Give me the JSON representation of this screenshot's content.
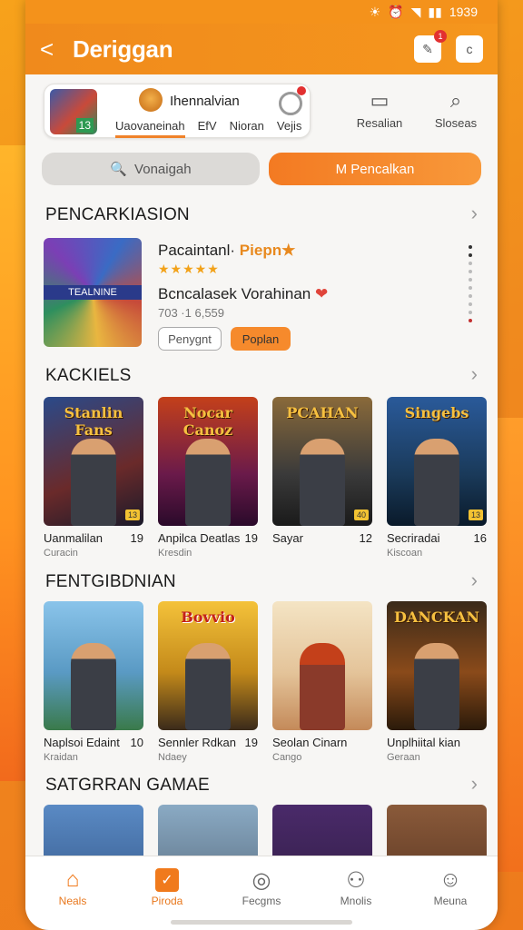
{
  "status_bar": {
    "time": "1939"
  },
  "app_bar": {
    "title": "Deriggan",
    "back_icon": "back-arrow-icon",
    "badge_count": "1",
    "right_icon": "c"
  },
  "category_strip": {
    "thumb_number": "13",
    "heading": "Ihennalvian",
    "tabs": [
      {
        "label": "Uaovaneinah",
        "active": true
      },
      {
        "label": "EfV",
        "active": false
      },
      {
        "label": "Nioran",
        "active": false
      },
      {
        "label": "Vejis",
        "active": false
      }
    ]
  },
  "side_actions": [
    {
      "label": "Resalian",
      "icon": "router-icon"
    },
    {
      "label": "Sloseas",
      "icon": "search-clock-icon"
    }
  ],
  "search": {
    "placeholder": "Vonaigah",
    "cta": "M Pencalkan"
  },
  "featured": {
    "section_title": "PENCARKIASION",
    "cover_band": "TEALNINE",
    "title": "Pacaintanl·",
    "title_highlight": "Piepn★",
    "stars": "★★★★★",
    "subtitle": "Bcncalasek  Vorahinan",
    "count": "703 ·1 6,559",
    "btn_outline": "Penygnt",
    "btn_fill": "Poplan"
  },
  "sections": [
    {
      "title": "KACKIELS",
      "games": [
        {
          "cover": "Stanlin Fans",
          "name": "Uanmalilan",
          "num": "19",
          "sub": "Curacin",
          "tag": "13"
        },
        {
          "cover": "Nocar Canoz",
          "name": "Anpilca Deatlas",
          "num": "19",
          "sub": "Kresdin",
          "tag": ""
        },
        {
          "cover": "PCAHAN",
          "name": "Sayar",
          "num": "12",
          "sub": "",
          "tag": "40"
        },
        {
          "cover": "Singebs",
          "name": "Secriradai",
          "num": "16",
          "sub": "Kiscoan",
          "tag": "13"
        }
      ]
    },
    {
      "title": "FENTGIBDNIAN",
      "games": [
        {
          "cover": "",
          "name": "Naplsoi Edaint",
          "num": "10",
          "sub": "Kraidan",
          "tag": ""
        },
        {
          "cover": "Bovvio",
          "name": "Sennler Rdkan",
          "num": "19",
          "sub": "Ndaey",
          "tag": ""
        },
        {
          "cover": "",
          "name": "Seolan Cinarn",
          "num": "",
          "sub": "Cango",
          "tag": ""
        },
        {
          "cover": "DANCKAN",
          "name": "Unplhiital kian",
          "num": "",
          "sub": "Geraan",
          "tag": ""
        }
      ]
    },
    {
      "title": "SATGRRAN GAMAE",
      "games": []
    }
  ],
  "bottom_nav": [
    {
      "label": "Neals",
      "icon": "home-icon",
      "active": true
    },
    {
      "label": "Piroda",
      "icon": "checkbox-icon",
      "active": true
    },
    {
      "label": "Fecgms",
      "icon": "chat-icon",
      "active": false
    },
    {
      "label": "Mnolis",
      "icon": "person-icon",
      "active": false
    },
    {
      "label": "Meuna",
      "icon": "profile-icon",
      "active": false
    }
  ],
  "colors": {
    "accent": "#f07a1c",
    "background": "#f7f6f4"
  }
}
